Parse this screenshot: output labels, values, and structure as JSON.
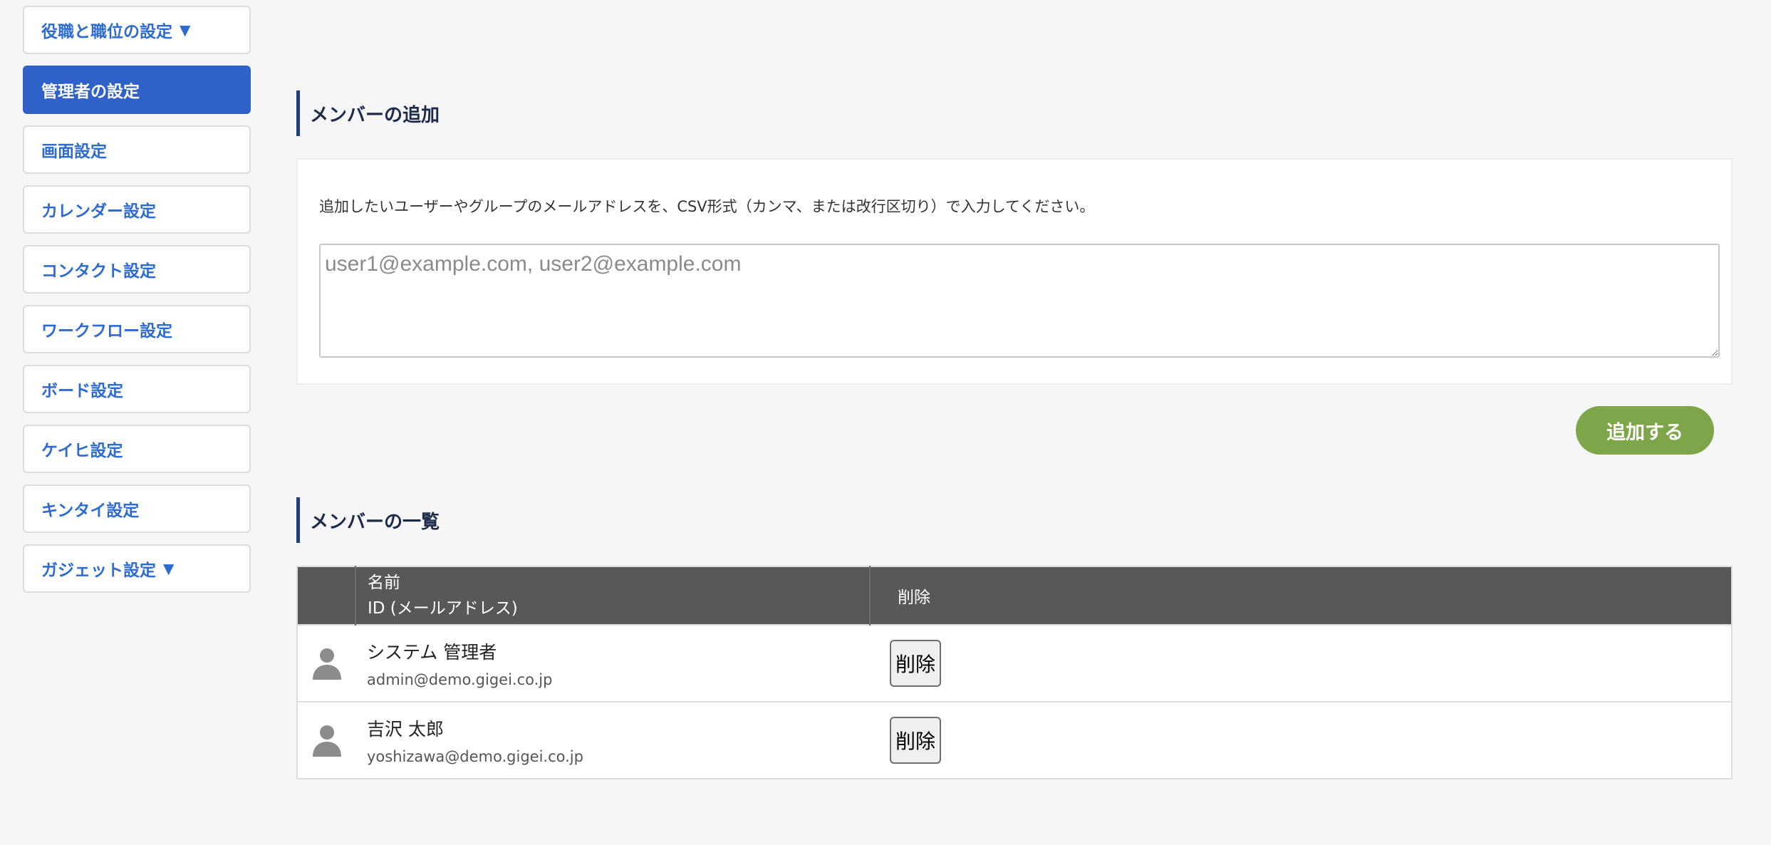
{
  "sidebar": {
    "items": [
      {
        "label": "役職と職位の設定",
        "caret": "▼"
      },
      {
        "label": "管理者の設定"
      },
      {
        "label": "画面設定"
      },
      {
        "label": "カレンダー設定"
      },
      {
        "label": "コンタクト設定"
      },
      {
        "label": "ワークフロー設定"
      },
      {
        "label": "ボード設定"
      },
      {
        "label": "ケイヒ設定"
      },
      {
        "label": "キンタイ設定"
      },
      {
        "label": "ガジェット設定",
        "caret": "▼"
      }
    ],
    "active_index": 1
  },
  "add_member": {
    "title": "メンバーの追加",
    "description": "追加したいユーザーやグループのメールアドレスを、CSV形式（カンマ、または改行区切り）で入力してください。",
    "placeholder": "user1@example.com, user2@example.com",
    "value": "",
    "button_label": "追加する"
  },
  "member_list": {
    "title": "メンバーの一覧",
    "headers": {
      "name_line1": "名前",
      "name_line2": "ID (メールアドレス)",
      "delete": "削除"
    },
    "rows": [
      {
        "name": "システム 管理者",
        "email": "admin@demo.gigei.co.jp",
        "delete_label": "削除"
      },
      {
        "name": "吉沢 太郎",
        "email": "yoshizawa@demo.gigei.co.jp",
        "delete_label": "削除"
      }
    ]
  },
  "colors": {
    "accent_blue": "#2e62c8",
    "link_blue": "#2d6bd1",
    "button_green": "#7ea54a",
    "table_header": "#585858",
    "section_bar": "#1f3f7a"
  }
}
